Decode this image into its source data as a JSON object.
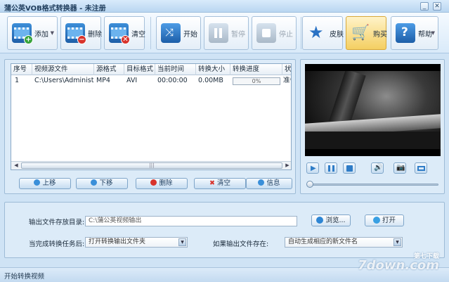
{
  "window": {
    "title": "蒲公英VOB格式转换器 - 未注册",
    "close_glyph": "✕"
  },
  "toolbar": {
    "add_label": "添加",
    "delete_label": "删除",
    "clear_label": "清空",
    "start_label": "开始",
    "pause_label": "暂停",
    "stop_label": "停止",
    "skin_label": "皮肤",
    "buy_label": "购买",
    "help_label": "帮助"
  },
  "file_list": {
    "columns": [
      "序号",
      "视频源文件",
      "源格式",
      "目标格式",
      "当前时间",
      "转换大小",
      "转换进度",
      "状"
    ],
    "rows": [
      {
        "index": "1",
        "source": "C:\\Users\\Administrator...",
        "src_format": "MP4",
        "dst_format": "AVI",
        "time": "00:00:00",
        "size": "0.00MB",
        "progress": "0%",
        "status": "准备"
      }
    ],
    "scroll_thumb": "|||",
    "buttons": {
      "up": "上移",
      "down": "下移",
      "delete": "删除",
      "clear": "清空",
      "info": "信息"
    }
  },
  "preview": {
    "volume": 0.0
  },
  "settings": {
    "output_dir_label": "输出文件存放目录:",
    "output_dir_value": "C:\\蒲公英视频输出",
    "browse_label": "浏览...",
    "open_label": "打开",
    "after_label": "当完成转换任务后:",
    "after_value": "打开转换输出文件夹",
    "exists_label": "如果输出文件存在:",
    "exists_value": "自动生成相应的新文件名"
  },
  "status": {
    "text": "开始转换视频"
  },
  "watermark": {
    "text": "7down.com",
    "sub": "第七下载"
  },
  "colors": {
    "accent": "#2e7cc7",
    "buy_highlight": "#f7d87c"
  }
}
